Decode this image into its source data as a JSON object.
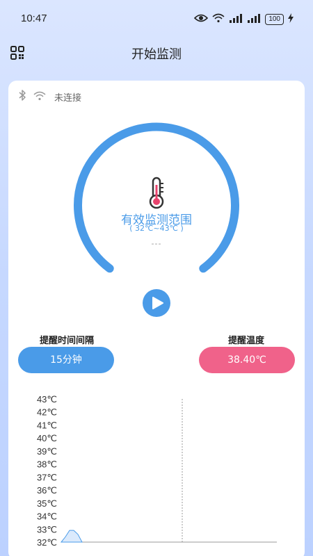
{
  "status_bar": {
    "time": "10:47",
    "battery": "100",
    "icons": [
      "eye-icon",
      "wifi-icon",
      "signal-icon",
      "signal-icon",
      "battery-icon",
      "charging-icon"
    ]
  },
  "header": {
    "title": "开始监测",
    "left_icon": "grid-icon"
  },
  "connection": {
    "status": "未连接",
    "icons": [
      "bluetooth-icon",
      "wifi-icon"
    ]
  },
  "gauge": {
    "title": "有效监测范围",
    "range": "( 32℃~43℃ )",
    "reading": "---",
    "color": "#4a9be8"
  },
  "controls": {
    "interval_label": "提醒时间间隔",
    "interval_value": "15分钟",
    "temp_label": "提醒温度",
    "temp_value": "38.40℃",
    "interval_color": "#4a9be8",
    "temp_color": "#f0628a"
  },
  "chart_data": {
    "type": "area",
    "y_ticks": [
      "43℃",
      "42℃",
      "41℃",
      "40℃",
      "39℃",
      "38℃",
      "37℃",
      "36℃",
      "35℃",
      "34℃",
      "33℃",
      "32℃"
    ],
    "ylim": [
      32,
      43
    ],
    "values": [
      32.0,
      32.4,
      32.9,
      32.9,
      32.6,
      32.0
    ],
    "grid": false
  }
}
